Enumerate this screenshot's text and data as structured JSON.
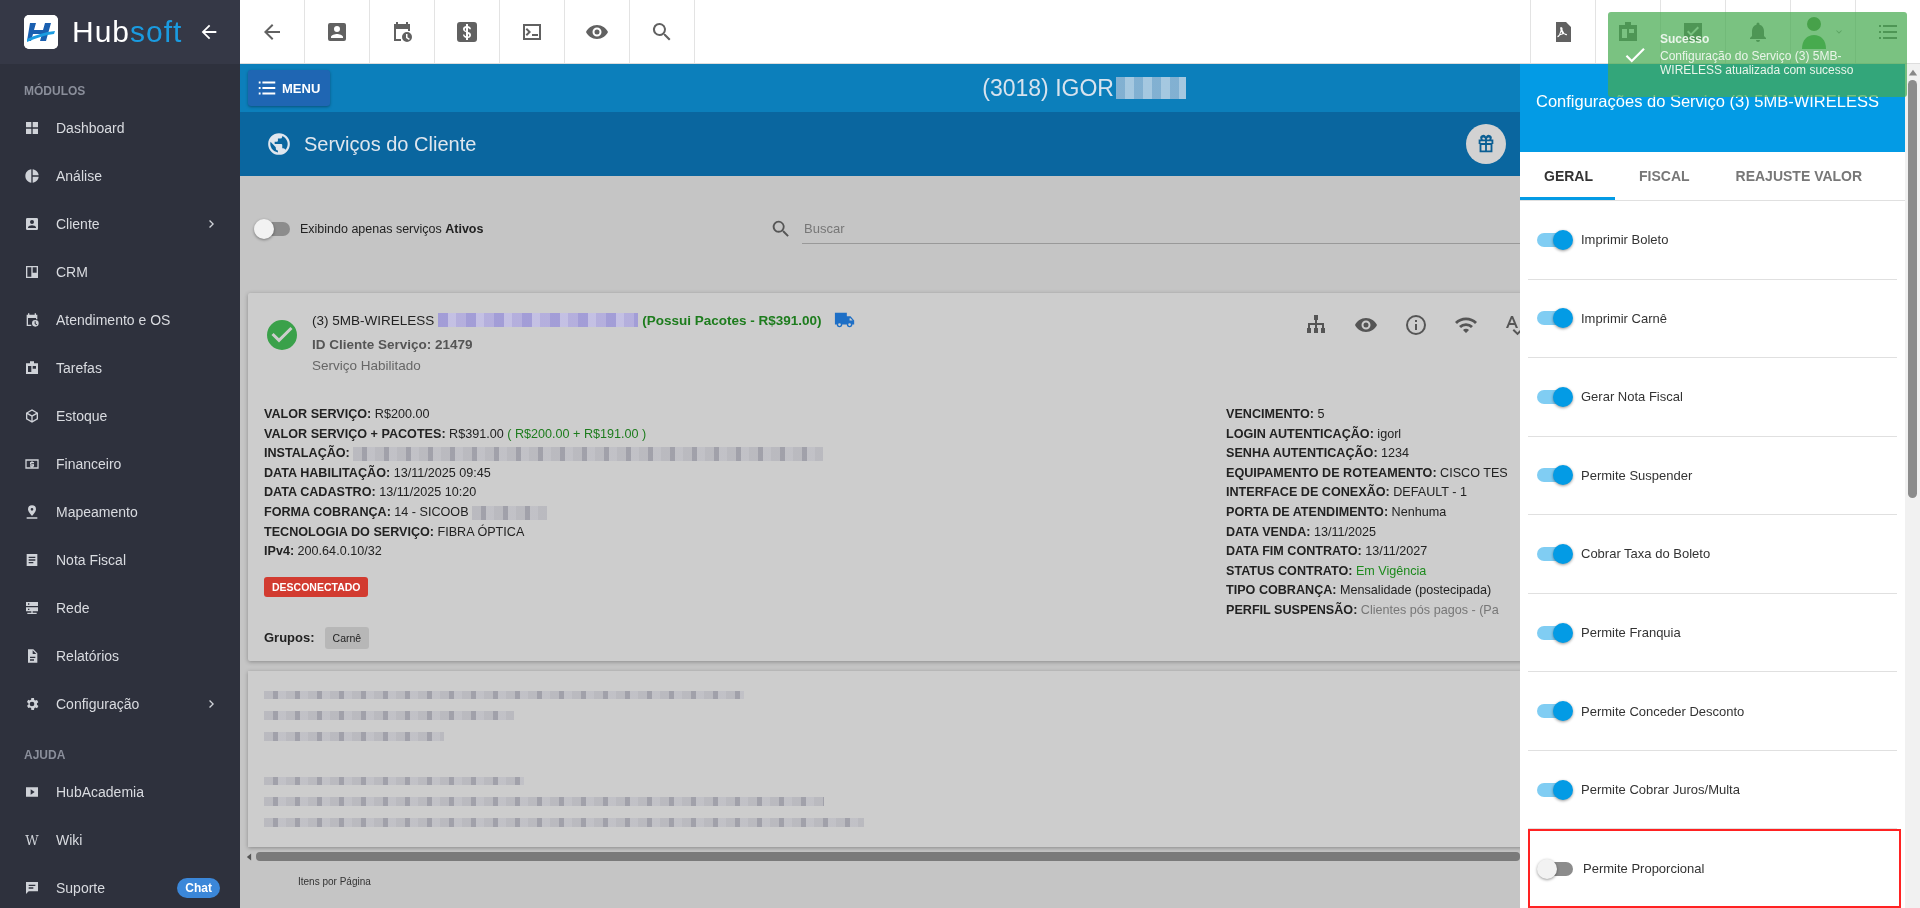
{
  "sidebar": {
    "logo": {
      "first": "Hub",
      "second": "soft"
    },
    "sections": [
      {
        "title": "MÓDULOS",
        "items": [
          {
            "label": "Dashboard",
            "expandable": false
          },
          {
            "label": "Análise",
            "expandable": false
          },
          {
            "label": "Cliente",
            "expandable": true
          },
          {
            "label": "CRM",
            "expandable": false
          },
          {
            "label": "Atendimento e OS",
            "expandable": false
          },
          {
            "label": "Tarefas",
            "expandable": false
          },
          {
            "label": "Estoque",
            "expandable": false
          },
          {
            "label": "Financeiro",
            "expandable": false
          },
          {
            "label": "Mapeamento",
            "expandable": false
          },
          {
            "label": "Nota Fiscal",
            "expandable": false
          },
          {
            "label": "Rede",
            "expandable": false
          },
          {
            "label": "Relatórios",
            "expandable": false
          },
          {
            "label": "Configuração",
            "expandable": true
          }
        ]
      },
      {
        "title": "AJUDA",
        "items": [
          {
            "label": "HubAcademia",
            "expandable": false
          },
          {
            "label": "Wiki",
            "expandable": false,
            "glyph": "W"
          },
          {
            "label": "Suporte",
            "expandable": false,
            "badge": "Chat"
          }
        ]
      }
    ]
  },
  "header": {
    "menu_button": "MENU",
    "client_title": "(3018) IGOR"
  },
  "page_title": "Serviços do Cliente",
  "filter": {
    "on": false,
    "label": "Exibindo apenas serviços **Ativos**"
  },
  "search": {
    "placeholder": "Buscar"
  },
  "service": {
    "name": "(3) 5MB-WIRELESS",
    "packages": "(Possui Pacotes - R$391.00)",
    "id_line": "ID Cliente Serviço: 21479",
    "status": "Serviço Habilitado",
    "left_fields": [
      {
        "label": "VALOR SERVIÇO:",
        "value": "R$200.00"
      },
      {
        "label": "VALOR SERVIÇO + PACOTES:",
        "value": "R$391.00",
        "extra": "( R$200.00 + R$191.00 )"
      },
      {
        "label": "INSTALAÇÃO:",
        "redacted": true
      },
      {
        "label": "DATA HABILITAÇÃO:",
        "value": "13/11/2025 09:45"
      },
      {
        "label": "DATA CADASTRO:",
        "value": "13/11/2025 10:20"
      },
      {
        "label": "FORMA COBRANÇA:",
        "value": "14 - SICOOB",
        "redacted": true
      },
      {
        "label": "TECNOLOGIA DO SERVIÇO:",
        "value": "FIBRA ÓPTICA"
      },
      {
        "label": "IPv4:",
        "value": "200.64.0.10/32"
      }
    ],
    "connection": "DESCONECTADO",
    "groups_label": "Grupos:",
    "groups": [
      "Carnê"
    ],
    "right_fields": [
      {
        "label": "VENCIMENTO:",
        "value": "5"
      },
      {
        "label": "LOGIN AUTENTICAÇÃO:",
        "value": "igorl"
      },
      {
        "label": "SENHA AUTENTICAÇÃO:",
        "value": "1234"
      },
      {
        "label": "EQUIPAMENTO DE ROTEAMENTO:",
        "value": "CISCO TES"
      },
      {
        "label": "INTERFACE DE CONEXÃO:",
        "value": "DEFAULT - 1"
      },
      {
        "label": "PORTA DE ATENDIMENTO:",
        "value": "Nenhuma"
      },
      {
        "label": "DATA VENDA:",
        "value": "13/11/2025"
      },
      {
        "label": "DATA FIM CONTRATO:",
        "value": "13/11/2027"
      },
      {
        "label": "STATUS CONTRATO:",
        "value": "Em Vigência",
        "color": "#1d8a1d"
      },
      {
        "label": "TIPO COBRANÇA:",
        "value": "Mensalidade (postecipada)"
      },
      {
        "label": "PERFIL SUSPENSÃO:",
        "value": "Clientes pós pagos - (Pa",
        "color": "#777777"
      }
    ]
  },
  "pagination_label": "Itens por Página",
  "panel": {
    "title": "Configurações do Serviço (3) 5MB-WIRELESS",
    "tabs": [
      {
        "label": "GERAL",
        "selected": true
      },
      {
        "label": "FISCAL",
        "selected": false
      },
      {
        "label": "REAJUSTE VALOR",
        "selected": false
      }
    ],
    "options": [
      {
        "label": "Imprimir Boleto",
        "on": true,
        "highlighted": false
      },
      {
        "label": "Imprimir Carnê",
        "on": true,
        "highlighted": false
      },
      {
        "label": "Gerar Nota Fiscal",
        "on": true,
        "highlighted": false
      },
      {
        "label": "Permite Suspender",
        "on": true,
        "highlighted": false
      },
      {
        "label": "Cobrar Taxa do Boleto",
        "on": true,
        "highlighted": false
      },
      {
        "label": "Permite Franquia",
        "on": true,
        "highlighted": false
      },
      {
        "label": "Permite Conceder Desconto",
        "on": true,
        "highlighted": false
      },
      {
        "label": "Permite Cobrar Juros/Multa",
        "on": true,
        "highlighted": false
      },
      {
        "label": "Permite Proporcional",
        "on": false,
        "highlighted": true
      }
    ]
  },
  "toast": {
    "title": "Sucesso",
    "message": "Configuração do Serviço (3) 5MB-WIRELESS atualizada com sucesso"
  }
}
